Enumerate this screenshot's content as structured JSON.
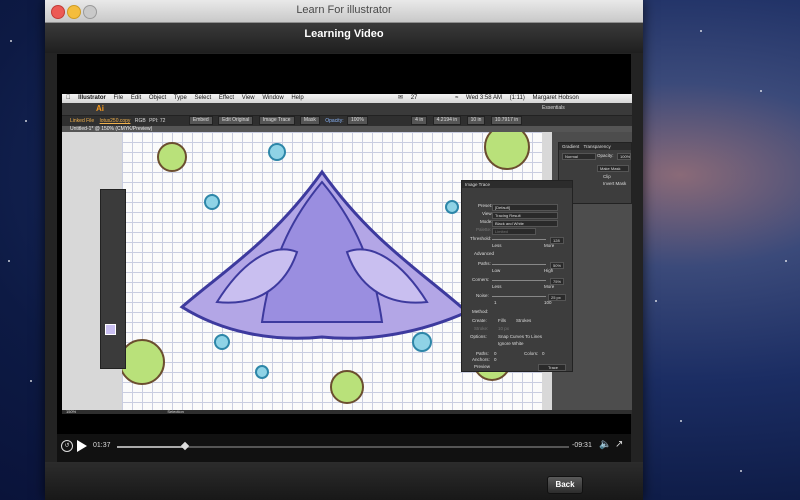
{
  "window": {
    "title": "Learn For illustrator"
  },
  "nav": {
    "title": "Learning Video"
  },
  "player": {
    "time_elapsed": "01:37",
    "time_remaining": "-09:31",
    "progress": 0.15
  },
  "footer": {
    "back_label": "Back"
  },
  "mac_menu": {
    "items": [
      "Illustrator",
      "File",
      "Edit",
      "Object",
      "Type",
      "Select",
      "Effect",
      "View",
      "Window",
      "Help"
    ],
    "right": {
      "battery": "27",
      "clock": "Wed 3:58 AM",
      "battery_time": "(1:11)",
      "user": "Margaret Hobson"
    }
  },
  "ai": {
    "workspace": "Essentials",
    "control": {
      "file": "Linked File",
      "filename": "lotus250.copy",
      "mode": "RGB",
      "ppi": "PPI: 72",
      "embed": "Embed",
      "edit_original": "Edit Original",
      "image_trace": "Image Trace",
      "mask": "Mask",
      "opacity_label": "Opacity:",
      "opacity": "100%",
      "x": "4 in",
      "w": "4.2194 in",
      "y": "10 in",
      "h": "10.7917 in"
    },
    "doc_tab": "Untitled-1* @ 150% (CMYK/Preview)",
    "zoom": "150%",
    "status": "Selection"
  },
  "transparency": {
    "tabs": [
      "Gradient",
      "Transparency"
    ],
    "blend": "Normal",
    "opacity_label": "Opacity:",
    "opacity": "100%",
    "make_mask": "Make Mask",
    "clip": "Clip",
    "invert": "Invert Mask"
  },
  "image_trace": {
    "title": "Image Trace",
    "preset_label": "Preset:",
    "preset": "[Default]",
    "view_label": "View:",
    "view": "Tracing Result",
    "mode_label": "Mode:",
    "mode": "Black and White",
    "palette_label": "Palette:",
    "palette": "Limited",
    "threshold_label": "Threshold:",
    "threshold": "128",
    "less": "Less",
    "more": "More",
    "advanced": "Advanced",
    "paths_label": "Paths:",
    "paths": "50%",
    "low": "Low",
    "high": "High",
    "corners_label": "Corners:",
    "corners": "75%",
    "noise_label": "Noise:",
    "noise": "25 px",
    "noise_min": "1",
    "noise_max": "100",
    "method_label": "Method:",
    "create_label": "Create:",
    "fills": "Fills",
    "strokes": "Strokes",
    "stroke_label": "Stroke:",
    "stroke": "10 px",
    "options_label": "Options:",
    "snap": "Snap Curves To Lines",
    "ignore_white": "Ignore White",
    "paths_count_label": "Paths:",
    "paths_count": "0",
    "colors_label": "Colors:",
    "colors_count": "0",
    "anchors_label": "Anchors:",
    "anchors_count": "0",
    "preview": "Preview",
    "trace": "Trace"
  }
}
